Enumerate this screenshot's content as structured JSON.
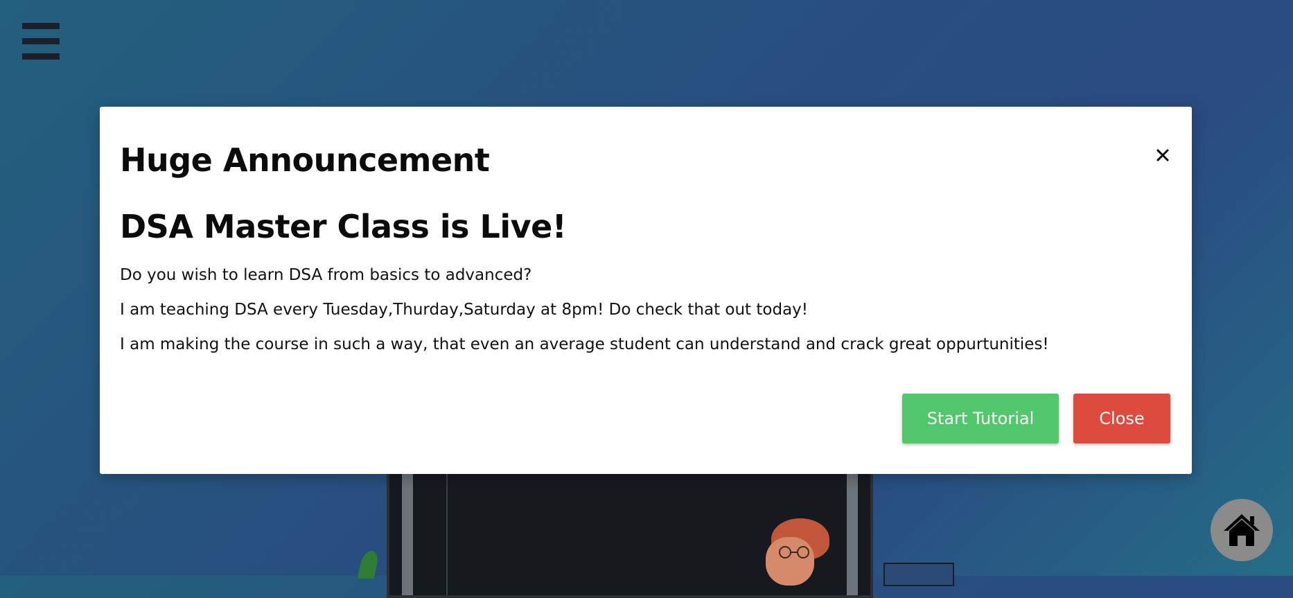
{
  "modal": {
    "title": "Huge Announcement",
    "subtitle": "DSA Master Class is Live!",
    "paragraphs": [
      "Do you wish to learn DSA from basics to advanced?",
      "I am teaching DSA every Tuesday,Thurday,Saturday at 8pm! Do check that out today!",
      "I am making the course in such a way, that even an average student can understand and crack great oppurtunities!"
    ],
    "close_icon": "close-icon",
    "start_label": "Start Tutorial",
    "close_label": "Close"
  },
  "icons": {
    "menu": "hamburger-menu-icon",
    "home": "home-icon"
  },
  "colors": {
    "start_button": "#52c76c",
    "close_button": "#dd4b3e",
    "home_button": "#8b8b8b"
  }
}
